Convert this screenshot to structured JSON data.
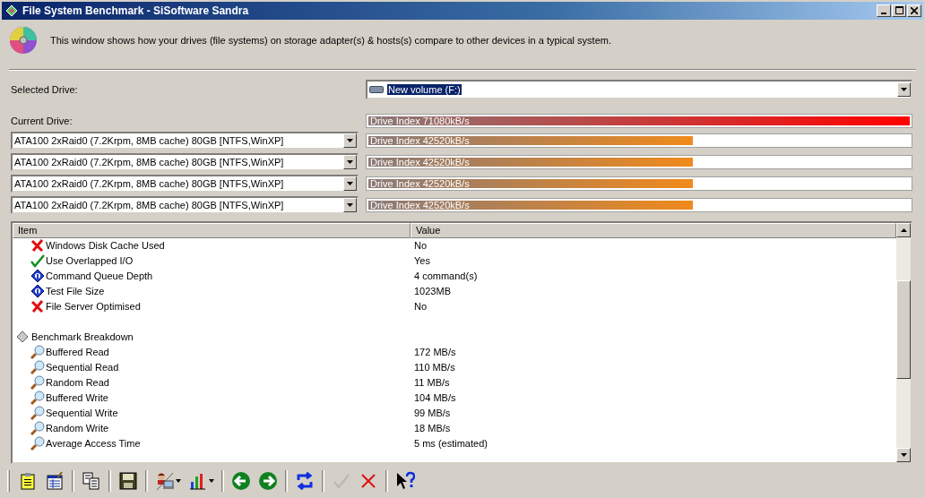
{
  "window": {
    "title": "File System Benchmark - SiSoftware Sandra"
  },
  "intro": "This window shows how your drives (file systems) on storage adapter(s) & hosts(s) compare to other devices in a typical system.",
  "selected_drive": {
    "label": "Selected Drive:",
    "value": "New volume (F:)"
  },
  "current_drive": {
    "label": "Current Drive:",
    "bar": {
      "text": "Drive Index 71080kB/s",
      "level": 1,
      "color": "#ff0000"
    }
  },
  "comparisons": [
    {
      "drive": "ATA100 2xRaid0 (7.2Krpm, 8MB cache) 80GB [NTFS,WinXP]",
      "bar": {
        "text": "Drive Index 42520kB/s",
        "level": 0.6,
        "color": "#f08a1c"
      }
    },
    {
      "drive": "ATA100 2xRaid0 (7.2Krpm, 8MB cache) 80GB [NTFS,WinXP]",
      "bar": {
        "text": "Drive Index 42520kB/s",
        "level": 0.6,
        "color": "#f08a1c"
      }
    },
    {
      "drive": "ATA100 2xRaid0 (7.2Krpm, 8MB cache) 80GB [NTFS,WinXP]",
      "bar": {
        "text": "Drive Index 42520kB/s",
        "level": 0.6,
        "color": "#f08a1c"
      }
    },
    {
      "drive": "ATA100 2xRaid0 (7.2Krpm, 8MB cache) 80GB [NTFS,WinXP]",
      "bar": {
        "text": "Drive Index 42520kB/s",
        "level": 0.6,
        "color": "#f08a1c"
      }
    }
  ],
  "table": {
    "columns": [
      "Item",
      "Value"
    ],
    "rows": [
      {
        "kind": "cross",
        "item": "Windows Disk Cache Used",
        "value": "No"
      },
      {
        "kind": "check",
        "item": "Use Overlapped I/O",
        "value": "Yes"
      },
      {
        "kind": "info",
        "item": "Command Queue Depth",
        "value": "4 command(s)"
      },
      {
        "kind": "info",
        "item": "Test File Size",
        "value": "1023MB"
      },
      {
        "kind": "cross",
        "item": "File Server Optimised",
        "value": "No"
      },
      {
        "kind": "group",
        "item": "Benchmark Breakdown",
        "children": [
          {
            "kind": "search",
            "item": "Buffered Read",
            "value": "172 MB/s"
          },
          {
            "kind": "search",
            "item": "Sequential Read",
            "value": "110 MB/s"
          },
          {
            "kind": "search",
            "item": "Random Read",
            "value": "11 MB/s"
          },
          {
            "kind": "search",
            "item": "Buffered Write",
            "value": "104 MB/s"
          },
          {
            "kind": "search",
            "item": "Sequential Write",
            "value": "99 MB/s"
          },
          {
            "kind": "search",
            "item": "Random Write",
            "value": "18 MB/s"
          },
          {
            "kind": "search",
            "item": "Average Access Time",
            "value": "5 ms (estimated)"
          }
        ]
      }
    ]
  },
  "toolbar": [
    {
      "kind": "clipboard",
      "dropdown": false,
      "disabled": false
    },
    {
      "kind": "report",
      "dropdown": false,
      "disabled": false
    },
    {
      "kind": "copy",
      "dropdown": false,
      "disabled": false
    },
    {
      "kind": "save",
      "dropdown": false,
      "disabled": false
    },
    {
      "kind": "user",
      "dropdown": true,
      "disabled": false
    },
    {
      "kind": "chart",
      "dropdown": true,
      "disabled": false
    },
    {
      "kind": "back",
      "dropdown": false,
      "disabled": false
    },
    {
      "kind": "forward",
      "dropdown": false,
      "disabled": false
    },
    {
      "kind": "refresh",
      "dropdown": false,
      "disabled": false
    },
    {
      "kind": "ok",
      "dropdown": false,
      "disabled": true
    },
    {
      "kind": "cancel",
      "dropdown": false,
      "disabled": false
    },
    {
      "kind": "help",
      "dropdown": false,
      "disabled": false
    }
  ]
}
